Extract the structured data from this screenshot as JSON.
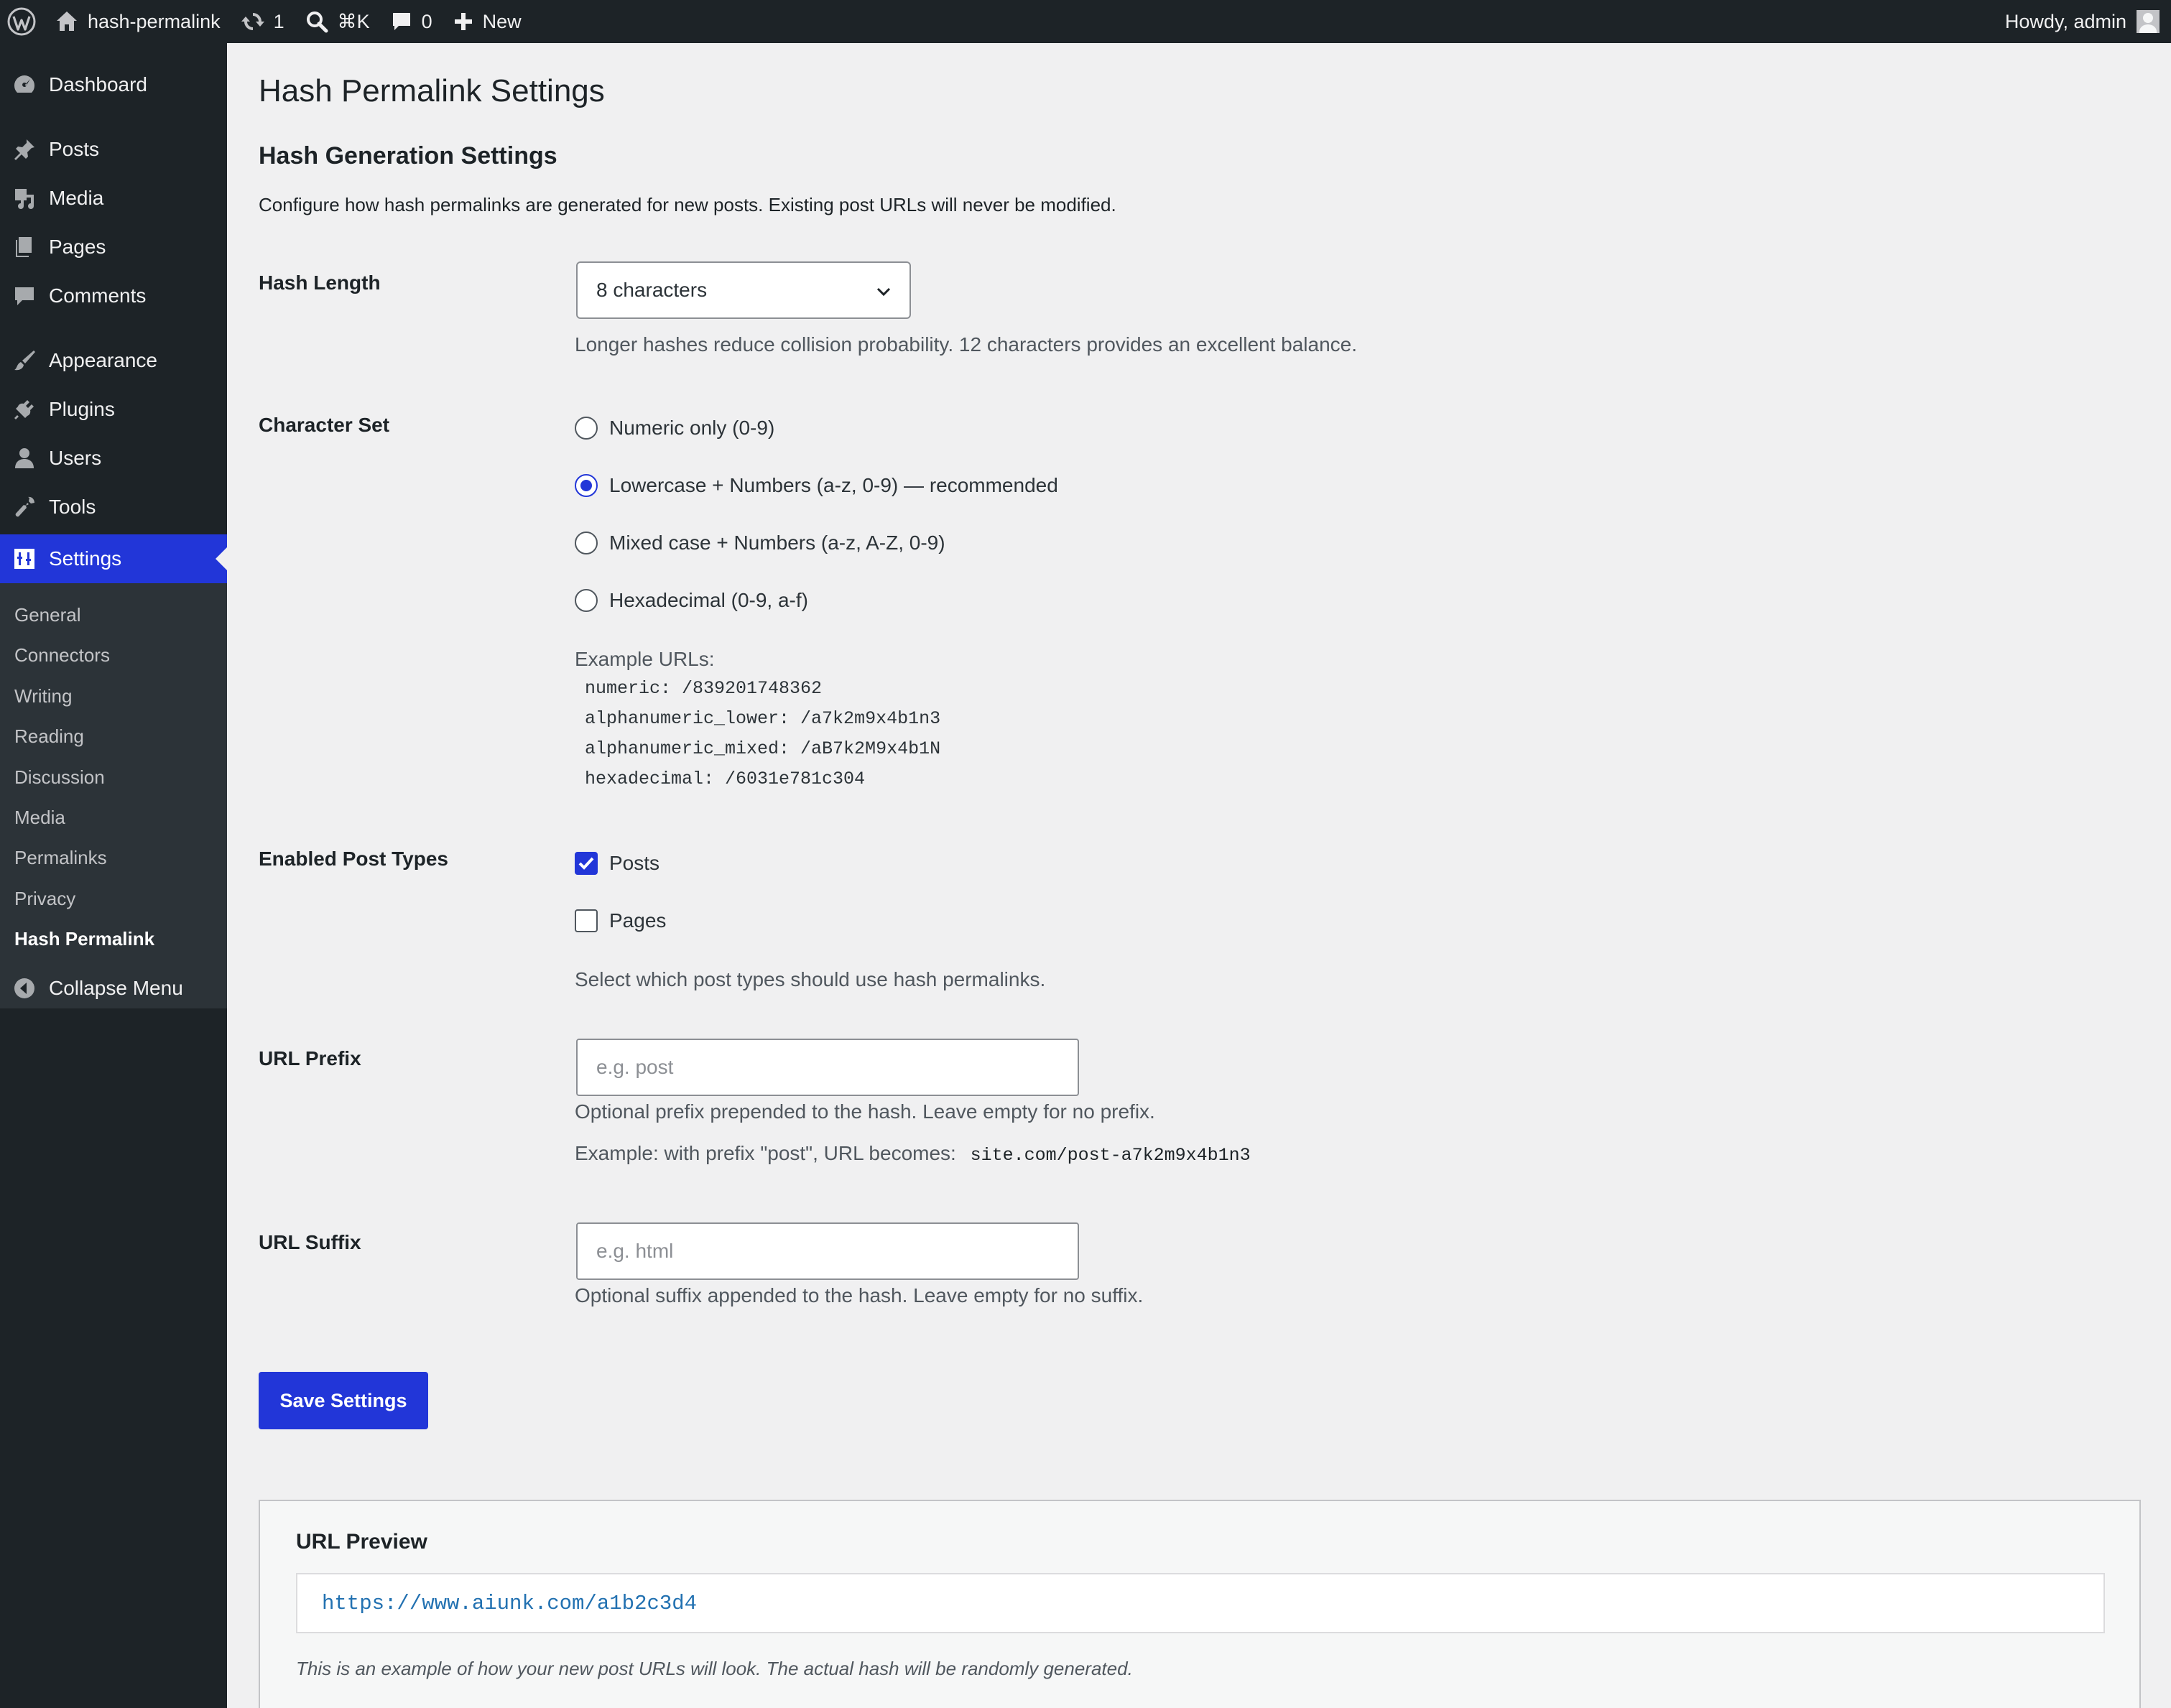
{
  "adminbar": {
    "site_name": "hash-permalink",
    "updates_count": "1",
    "search_shortcut": "⌘K",
    "comments_count": "0",
    "new_label": "New",
    "greeting": "Howdy, admin"
  },
  "sidebar": {
    "items": [
      {
        "label": "Dashboard",
        "icon": "dashboard-icon"
      },
      {
        "label": "Posts",
        "icon": "pin-icon"
      },
      {
        "label": "Media",
        "icon": "media-icon"
      },
      {
        "label": "Pages",
        "icon": "pages-icon"
      },
      {
        "label": "Comments",
        "icon": "comment-icon"
      },
      {
        "label": "Appearance",
        "icon": "brush-icon"
      },
      {
        "label": "Plugins",
        "icon": "plugin-icon"
      },
      {
        "label": "Users",
        "icon": "user-icon"
      },
      {
        "label": "Tools",
        "icon": "wrench-icon"
      },
      {
        "label": "Settings",
        "icon": "settings-icon"
      }
    ],
    "submenu": [
      "General",
      "Connectors",
      "Writing",
      "Reading",
      "Discussion",
      "Media",
      "Permalinks",
      "Privacy",
      "Hash Permalink"
    ],
    "collapse_label": "Collapse Menu"
  },
  "page": {
    "title": "Hash Permalink Settings",
    "section_title": "Hash Generation Settings",
    "section_desc": "Configure how hash permalinks are generated for new posts. Existing post URLs will never be modified."
  },
  "hash_length": {
    "label": "Hash Length",
    "selected": "8 characters",
    "help": "Longer hashes reduce collision probability. 12 characters provides an excellent balance."
  },
  "charset": {
    "label": "Character Set",
    "options": [
      {
        "label": "Numeric only (0-9)",
        "checked": false
      },
      {
        "label": "Lowercase + Numbers (a-z, 0-9) — recommended",
        "checked": true
      },
      {
        "label": "Mixed case + Numbers (a-z, A-Z, 0-9)",
        "checked": false
      },
      {
        "label": "Hexadecimal (0-9, a-f)",
        "checked": false
      }
    ],
    "examples_label": "Example URLs:",
    "examples": [
      "numeric: /839201748362",
      "alphanumeric_lower: /a7k2m9x4b1n3",
      "alphanumeric_mixed: /aB7k2M9x4b1N",
      "hexadecimal: /6031e781c304"
    ]
  },
  "post_types": {
    "label": "Enabled Post Types",
    "options": [
      {
        "label": "Posts",
        "checked": true
      },
      {
        "label": "Pages",
        "checked": false
      }
    ],
    "help": "Select which post types should use hash permalinks."
  },
  "prefix": {
    "label": "URL Prefix",
    "value": "",
    "placeholder": "e.g. post",
    "help": "Optional prefix prepended to the hash. Leave empty for no prefix.",
    "example_text": "Example: with prefix \"post\", URL becomes:",
    "example_url": "site.com/post-a7k2m9x4b1n3"
  },
  "suffix": {
    "label": "URL Suffix",
    "value": "",
    "placeholder": "e.g. html",
    "help": "Optional suffix appended to the hash. Leave empty for no suffix."
  },
  "save_label": "Save Settings",
  "preview": {
    "title": "URL Preview",
    "url": "https://www.aiunk.com/a1b2c3d4",
    "note": "This is an example of how your new post URLs will look. The actual hash will be randomly generated."
  }
}
